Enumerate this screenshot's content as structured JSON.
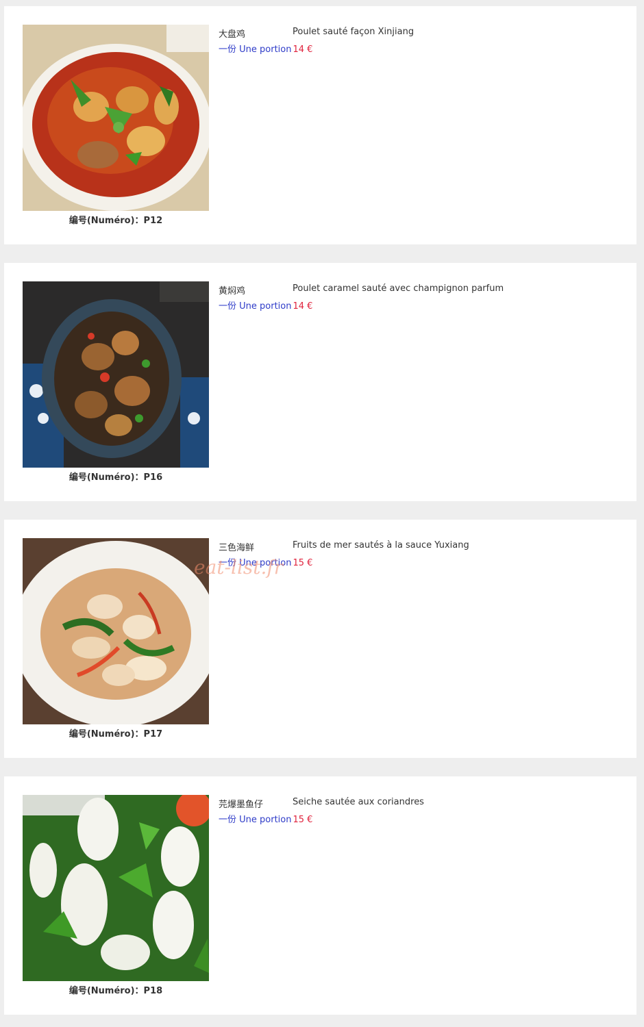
{
  "accent_colors": {
    "portion": "#2e3bc8",
    "price": "#e0223c",
    "background": "#eeeeee"
  },
  "dishes": [
    {
      "number_label": "编号(Numéro)：P12",
      "name_cn": "大盘鸡",
      "name_fr": "Poulet sauté façon Xinjiang",
      "portion_label": "一份 Une portion",
      "price": "14 €"
    },
    {
      "number_label": "编号(Numéro)：P16",
      "name_cn": "黄焖鸡",
      "name_fr": "Poulet caramel sauté avec champignon parfum",
      "portion_label": "一份 Une portion",
      "price": "14 €"
    },
    {
      "number_label": "编号(Numéro)：P17",
      "name_cn": "三色海鲜",
      "name_fr": "Fruits de mer sautés à la sauce Yuxiang",
      "portion_label": "一份 Une portion",
      "price": "15 €"
    },
    {
      "number_label": "编号(Numéro)：P18",
      "name_cn": "芫爆墨鱼仔",
      "name_fr": "Seiche sautée aux coriandres",
      "portion_label": "一份 Une portion",
      "price": "15 €"
    }
  ],
  "watermark": "eat-list.fr"
}
